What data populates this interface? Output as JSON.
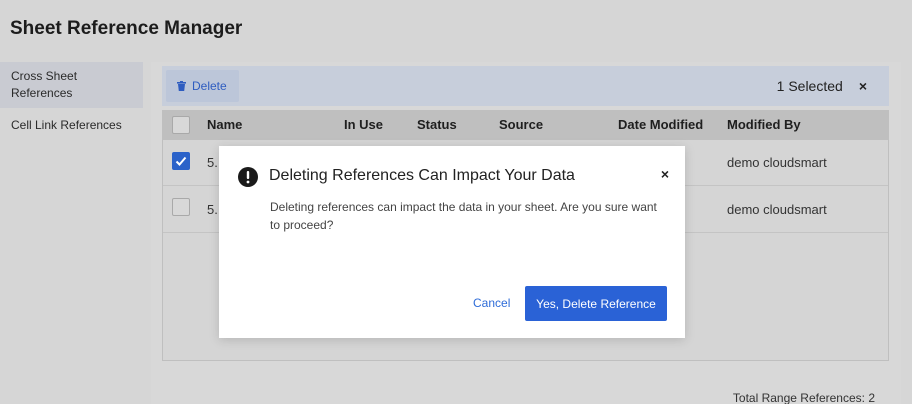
{
  "header": {
    "title": "Sheet Reference Manager"
  },
  "sidebar": {
    "items": [
      {
        "label": "Cross Sheet References"
      },
      {
        "label": "Cell Link References"
      }
    ]
  },
  "toolbar": {
    "delete_label": "Delete",
    "selected_text": "1 Selected",
    "close_symbol": "×"
  },
  "table": {
    "columns": [
      "Name",
      "In Use",
      "Status",
      "Source",
      "Date Modified",
      "Modified By"
    ],
    "rows": [
      {
        "checked": true,
        "name": "5..",
        "modified_by": "demo cloudsmart"
      },
      {
        "checked": false,
        "name": "5..",
        "modified_by": "demo cloudsmart"
      }
    ]
  },
  "footer": {
    "total": "Total Range References: 2"
  },
  "modal": {
    "title": "Deleting References Can Impact Your Data",
    "body": "Deleting references can impact the data in your sheet. Are you sure want to proceed?",
    "cancel_label": "Cancel",
    "confirm_label": "Yes, Delete Reference",
    "close_symbol": "×"
  },
  "colors": {
    "accent": "#2a62d6",
    "overlay": "#d6d6d6"
  }
}
